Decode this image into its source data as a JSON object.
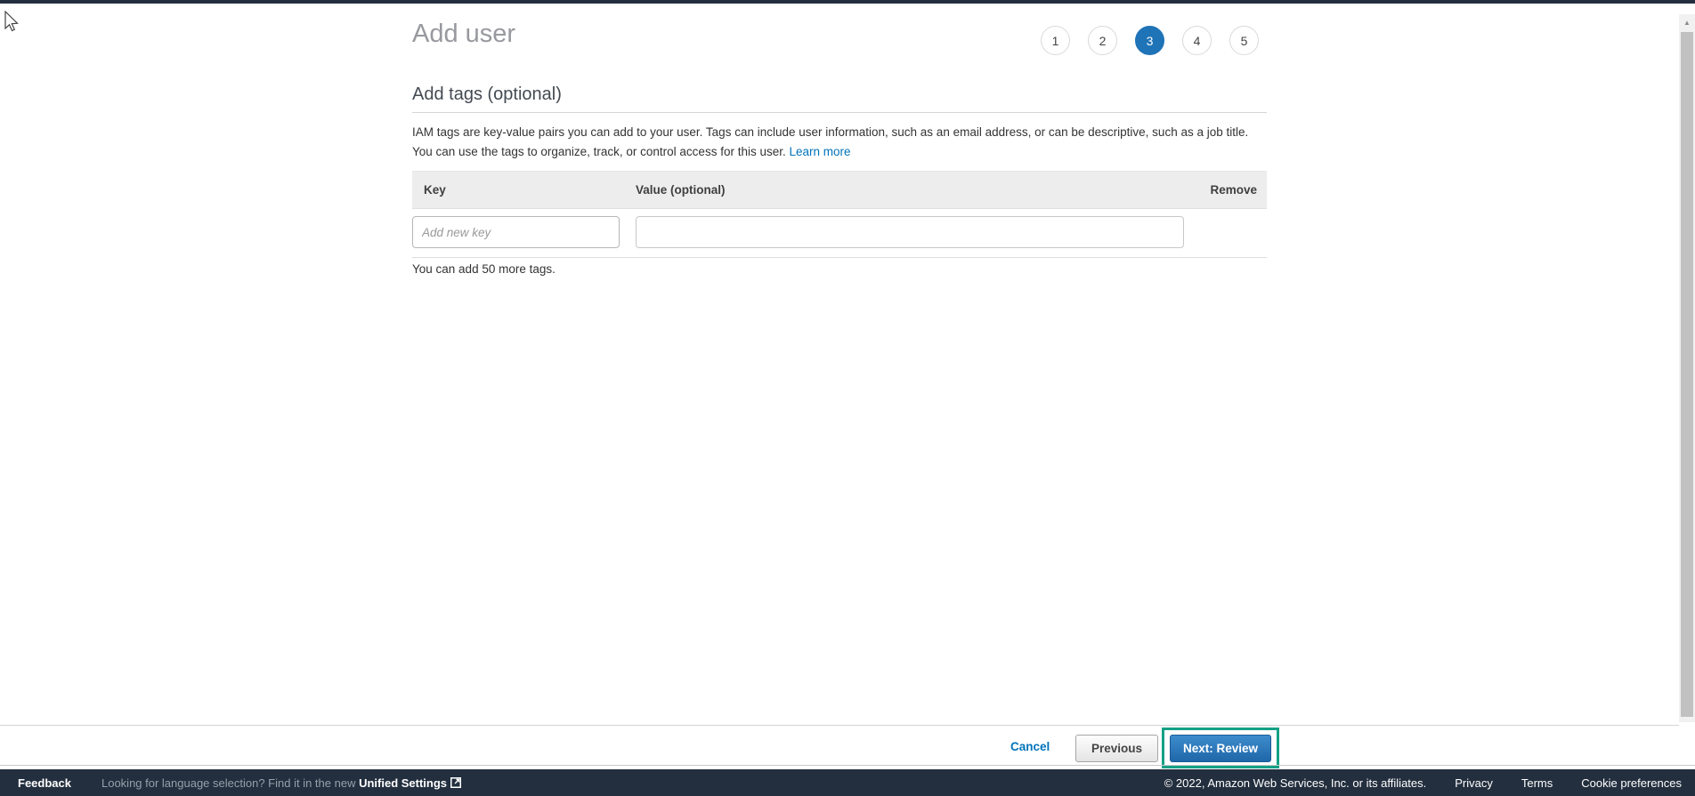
{
  "page": {
    "title": "Add user"
  },
  "wizard": {
    "steps": [
      {
        "label": "1",
        "active": false
      },
      {
        "label": "2",
        "active": false
      },
      {
        "label": "3",
        "active": true
      },
      {
        "label": "4",
        "active": false
      },
      {
        "label": "5",
        "active": false
      }
    ]
  },
  "section": {
    "heading": "Add tags (optional)",
    "description": "IAM tags are key-value pairs you can add to your user. Tags can include user information, such as an email address, or can be descriptive, such as a job title. You can use the tags to organize, track, or control access for this user.",
    "learn_more_label": "Learn more"
  },
  "tags_table": {
    "columns": [
      "Key",
      "Value (optional)",
      "Remove"
    ],
    "key_placeholder": "Add new key",
    "value_placeholder": "",
    "hint": "You can add 50 more tags."
  },
  "actions": {
    "cancel_label": "Cancel",
    "previous_label": "Previous",
    "next_label": "Next: Review"
  },
  "footer": {
    "feedback_label": "Feedback",
    "language_hint": "Looking for language selection? Find it in the new ",
    "unified_settings_label": "Unified Settings",
    "copyright": "© 2022, Amazon Web Services, Inc. or its affiliates.",
    "privacy_label": "Privacy",
    "terms_label": "Terms",
    "cookie_label": "Cookie preferences"
  },
  "colors": {
    "accent_blue": "#1f73b7",
    "link_blue": "#0073bb",
    "highlight_teal": "#14a085",
    "navy_bar": "#232f3e",
    "table_header_bg": "#ededed"
  }
}
